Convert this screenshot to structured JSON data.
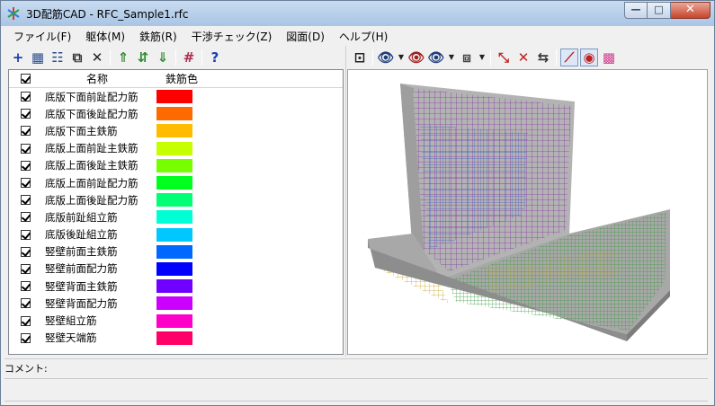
{
  "window": {
    "title": "3D配筋CAD - RFC_Sample1.rfc",
    "minimize": "—",
    "maximize": "□",
    "close": "✕"
  },
  "menu": [
    "ファイル(F)",
    "躯体(M)",
    "鉄筋(R)",
    "干渉チェック(Z)",
    "図面(D)",
    "ヘルプ(H)"
  ],
  "toolbar_left": [
    {
      "icon": "plus-icon",
      "glyph": "+",
      "color": "#1a3fb0"
    },
    {
      "icon": "image-list-icon",
      "glyph": "▦",
      "color": "#2b4e8c"
    },
    {
      "icon": "grid-lines-icon",
      "glyph": "☷",
      "color": "#2b4e8c"
    },
    {
      "icon": "copy-icon",
      "glyph": "⧉",
      "color": "#333333"
    },
    {
      "icon": "delete-icon",
      "glyph": "✕",
      "color": "#222222"
    },
    {
      "icon": "move-up-icon",
      "glyph": "⇑",
      "color": "#2e8b2e"
    },
    {
      "icon": "sort-icon",
      "glyph": "⇵",
      "color": "#2e8b2e"
    },
    {
      "icon": "move-down-icon",
      "glyph": "⇓",
      "color": "#2e8b2e"
    },
    {
      "icon": "hash-grid-icon",
      "glyph": "#",
      "color": "#b03050"
    },
    {
      "icon": "help-icon",
      "glyph": "?",
      "color": "#1a3fb0"
    }
  ],
  "toolbar_right": [
    {
      "icon": "fit-view-icon",
      "glyph": "⊡",
      "color": "#222222"
    },
    {
      "icon": "binoculars-icon",
      "glyph": "👁",
      "color": "#1f3c7a"
    },
    {
      "icon": "dropdown-arrow-icon",
      "glyph": "▼",
      "color": "#222222",
      "small": true
    },
    {
      "icon": "binoculars-red-icon",
      "glyph": "👁",
      "color": "#a02020"
    },
    {
      "icon": "binoculars-color-icon",
      "glyph": "👁",
      "color": "#1f3c7a"
    },
    {
      "icon": "dropdown-arrow-icon",
      "glyph": "▼",
      "color": "#222222",
      "small": true
    },
    {
      "icon": "view-3d-icon",
      "glyph": "⧈",
      "color": "#444444"
    },
    {
      "icon": "dropdown-arrow-icon",
      "glyph": "▼",
      "color": "#222222",
      "small": true
    },
    {
      "icon": "rebar-red-icon",
      "glyph": "⤡",
      "color": "#c02020"
    },
    {
      "icon": "rebar-cross-icon",
      "glyph": "✕",
      "color": "#c02020"
    },
    {
      "icon": "arrows-icon",
      "glyph": "⇆",
      "color": "#333333"
    },
    {
      "icon": "check-interference-icon",
      "glyph": "⟋",
      "color": "#c02020",
      "pressed": true
    },
    {
      "icon": "target-icon",
      "glyph": "◉",
      "color": "#c02020",
      "pressed": true
    },
    {
      "icon": "palette-icon",
      "glyph": "▩",
      "color": "#d04090"
    }
  ],
  "grid": {
    "header_name": "名称",
    "header_color": "鉄筋色",
    "rows": [
      {
        "name": "底版下面前趾配力筋",
        "color": "#ff0000"
      },
      {
        "name": "底版下面後趾配力筋",
        "color": "#ff6a00"
      },
      {
        "name": "底版下面主鉄筋",
        "color": "#ffbb00"
      },
      {
        "name": "底版上面前趾主鉄筋",
        "color": "#c6ff00"
      },
      {
        "name": "底版上面後趾主鉄筋",
        "color": "#77ff00"
      },
      {
        "name": "底版上面前趾配力筋",
        "color": "#00ff1e"
      },
      {
        "name": "底版上面後趾配力筋",
        "color": "#00ff74"
      },
      {
        "name": "底版前趾組立筋",
        "color": "#00ffd5"
      },
      {
        "name": "底版後趾組立筋",
        "color": "#00c8ff"
      },
      {
        "name": "竪壁前面主鉄筋",
        "color": "#0067ff"
      },
      {
        "name": "竪壁前面配力筋",
        "color": "#0000ff"
      },
      {
        "name": "竪壁背面主鉄筋",
        "color": "#7000ff"
      },
      {
        "name": "竪壁背面配力筋",
        "color": "#cc00ff"
      },
      {
        "name": "竪壁組立筋",
        "color": "#ff00c8"
      },
      {
        "name": "竪壁天端筋",
        "color": "#ff0068"
      }
    ]
  },
  "comment_label": "コメント:"
}
